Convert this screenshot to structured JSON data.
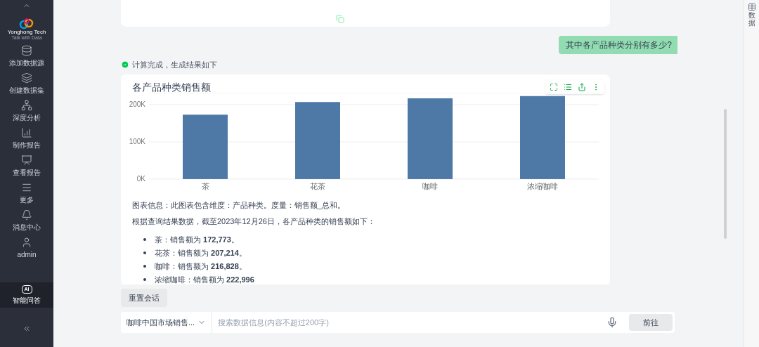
{
  "sidebar": {
    "logo": {
      "name": "Yonghong Tech",
      "tagline": "Talk with Data"
    },
    "items": [
      {
        "label": "添加数据源",
        "selected": false
      },
      {
        "label": "创建数据集",
        "selected": false
      },
      {
        "label": "深度分析",
        "selected": false
      },
      {
        "label": "制作报告",
        "selected": false
      },
      {
        "label": "查看报告",
        "selected": false
      },
      {
        "label": "更多",
        "selected": false
      },
      {
        "label": "消息中心",
        "selected": false
      },
      {
        "label": "admin",
        "selected": false
      }
    ],
    "bottom_item": {
      "label": "智能问答",
      "icon_text": "AI",
      "selected": true
    }
  },
  "right_panel": {
    "label": "数据"
  },
  "chat": {
    "user_message": "其中各产品种类分别有多少?",
    "status": "计算完成，生成结果如下",
    "chart_card": {
      "title": "各产品种类销售额",
      "chart_data": {
        "type": "bar",
        "categories": [
          "茶",
          "花茶",
          "咖啡",
          "浓缩咖啡"
        ],
        "values": [
          173000,
          207000,
          217000,
          223000
        ],
        "ylim": [
          0,
          232000
        ],
        "yticks": [
          {
            "value": 0,
            "label": "0K"
          },
          {
            "value": 100000,
            "label": "100K"
          },
          {
            "value": 200000,
            "label": "200K"
          }
        ],
        "color": "#4e79a7"
      },
      "info": "图表信息：此图表包含维度：产品种类。度量：销售额_总和。",
      "summary": "根据查询结果数据，截至2023年12月26日，各产品种类的销售额如下：",
      "bullets": [
        "茶：销售额为 **172,773**。",
        "花茶：销售额为 **207,214**。",
        "咖啡：销售额为 **216,828**。",
        "浓缩咖啡：销售额为 **222,996**"
      ]
    }
  },
  "reset_button": "重置会话",
  "input_bar": {
    "dataset": "咖啡中国市场销售...",
    "placeholder": "搜索数据信息(内容不超过200字)",
    "submit": "前往"
  }
}
